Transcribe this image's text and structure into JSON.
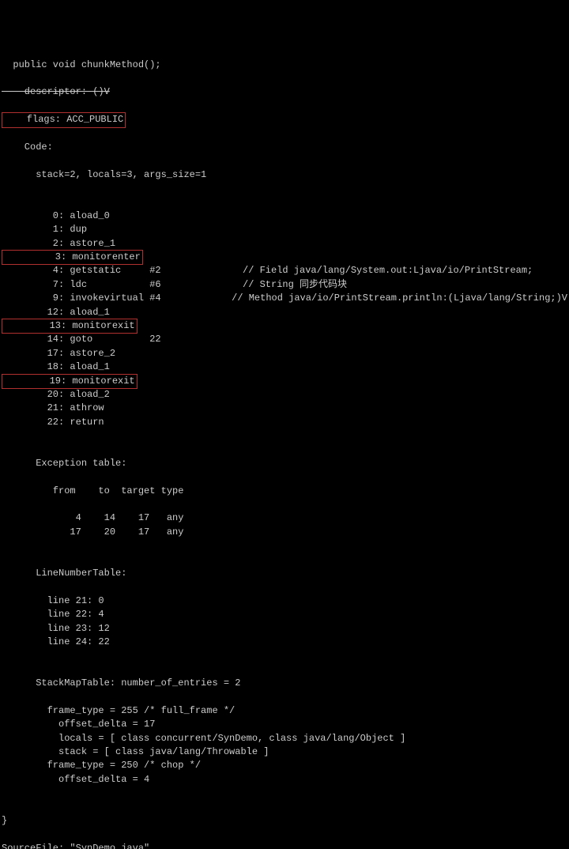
{
  "header": {
    "signature": "  public void chunkMethod();",
    "descriptor_strike": "    descriptor: ()V",
    "flags_boxed": "    flags: ACC_PUBLIC",
    "code_label": "    Code:",
    "stack_line": "      stack=2, locals=3, args_size=1"
  },
  "instructions": [
    {
      "left": "         0: aload_0",
      "right": "",
      "boxed": false
    },
    {
      "left": "         1: dup",
      "right": "",
      "boxed": false
    },
    {
      "left": "         2: astore_1",
      "right": "",
      "boxed": false
    },
    {
      "left": "         3: monitorenter",
      "right": "",
      "boxed": true
    },
    {
      "left": "         4: getstatic     #2",
      "right": "// Field java/lang/System.out:Ljava/io/PrintStream;",
      "boxed": false
    },
    {
      "left": "         7: ldc           #6",
      "right": "// String 同步代码块",
      "boxed": false
    },
    {
      "left": "         9: invokevirtual #4",
      "right": "// Method java/io/PrintStream.println:(Ljava/lang/String;)V",
      "boxed": false
    },
    {
      "left": "        12: aload_1",
      "right": "",
      "boxed": false
    },
    {
      "left": "        13: monitorexit",
      "right": "",
      "boxed": true
    },
    {
      "left": "        14: goto          22",
      "right": "",
      "boxed": false
    },
    {
      "left": "        17: astore_2",
      "right": "",
      "boxed": false
    },
    {
      "left": "        18: aload_1",
      "right": "",
      "boxed": false
    },
    {
      "left": "        19: monitorexit",
      "right": "",
      "boxed": true
    },
    {
      "left": "        20: aload_2",
      "right": "",
      "boxed": false
    },
    {
      "left": "        21: athrow",
      "right": "",
      "boxed": false
    },
    {
      "left": "        22: return",
      "right": "",
      "boxed": false
    }
  ],
  "exception_table": {
    "header": "      Exception table:",
    "cols": "         from    to  target type",
    "rows": [
      "             4    14    17   any",
      "            17    20    17   any"
    ]
  },
  "linenumber_table": {
    "header": "      LineNumberTable:",
    "rows": [
      "        line 21: 0",
      "        line 22: 4",
      "        line 23: 12",
      "        line 24: 22"
    ]
  },
  "stackmap": {
    "header": "      StackMapTable: number_of_entries = 2",
    "rows": [
      "        frame_type = 255 /* full_frame */",
      "          offset_delta = 17",
      "          locals = [ class concurrent/SynDemo, class java/lang/Object ]",
      "          stack = [ class java/lang/Throwable ]",
      "        frame_type = 250 /* chop */",
      "          offset_delta = 4"
    ]
  },
  "footer": {
    "brace": "}",
    "sourcefile": "SourceFile: \"SynDemo.java\""
  }
}
